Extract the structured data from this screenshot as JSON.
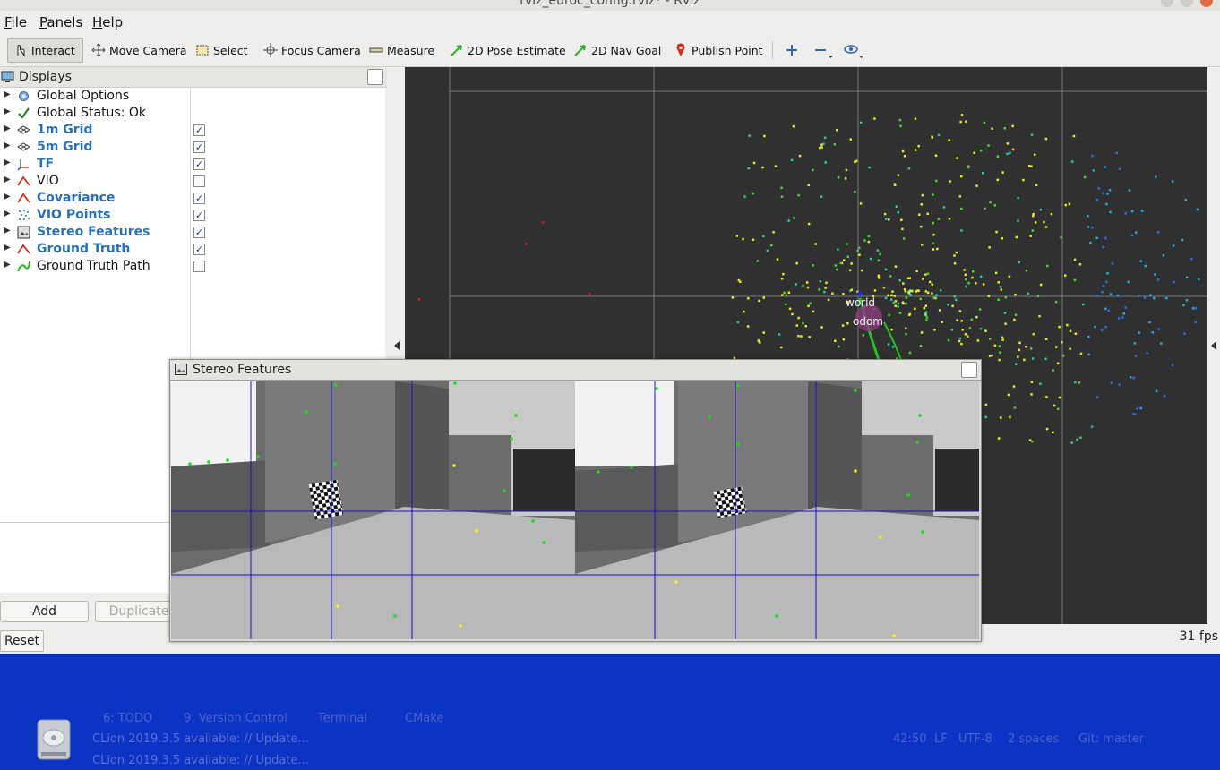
{
  "window": {
    "title": "rviz_euroc_config.rviz* - RViz"
  },
  "menu": [
    "File",
    "Panels",
    "Help"
  ],
  "toolbar": {
    "tools": [
      "Interact",
      "Move Camera",
      "Select",
      "Focus Camera",
      "Measure",
      "2D Pose Estimate",
      "2D Nav Goal",
      "Publish Point"
    ]
  },
  "displays_panel": {
    "title": "Displays",
    "items": [
      {
        "label": "Global Options",
        "icon": "gear-icon",
        "checked": null,
        "enabled": false
      },
      {
        "label": "Global Status: Ok",
        "icon": "check-icon",
        "checked": null,
        "enabled": false
      },
      {
        "label": "1m Grid",
        "icon": "grid-icon",
        "checked": true,
        "enabled": true
      },
      {
        "label": "5m Grid",
        "icon": "grid-icon",
        "checked": true,
        "enabled": true
      },
      {
        "label": "TF",
        "icon": "tf-axes-icon",
        "checked": true,
        "enabled": true
      },
      {
        "label": "VIO",
        "icon": "odometry-icon",
        "checked": false,
        "enabled": false
      },
      {
        "label": "Covariance",
        "icon": "odometry-icon",
        "checked": true,
        "enabled": true
      },
      {
        "label": "VIO Points",
        "icon": "pointcloud-icon",
        "checked": true,
        "enabled": true
      },
      {
        "label": "Stereo Features",
        "icon": "image-icon",
        "checked": true,
        "enabled": true
      },
      {
        "label": "Ground Truth",
        "icon": "odometry-icon",
        "checked": true,
        "enabled": true
      },
      {
        "label": "Ground Truth Path",
        "icon": "path-icon",
        "checked": false,
        "enabled": false
      }
    ],
    "buttons": {
      "add": "Add",
      "duplicate": "Duplicate"
    },
    "reset": "Reset"
  },
  "view3d": {
    "frames": [
      "world",
      "odom"
    ],
    "fps": "31 fps"
  },
  "stereo_window": {
    "title": "Stereo Features"
  },
  "background_ide": {
    "tabs": [
      "6: TODO",
      "9: Version Control",
      "Terminal",
      "CMake"
    ],
    "status_lines": [
      "CLion 2019.3.5 available: // Update...",
      "CLion 2019.3.5 available: // Update..."
    ],
    "status_right": [
      "42:50",
      "LF",
      "UTF-8",
      "2 spaces",
      "Git: master"
    ]
  }
}
